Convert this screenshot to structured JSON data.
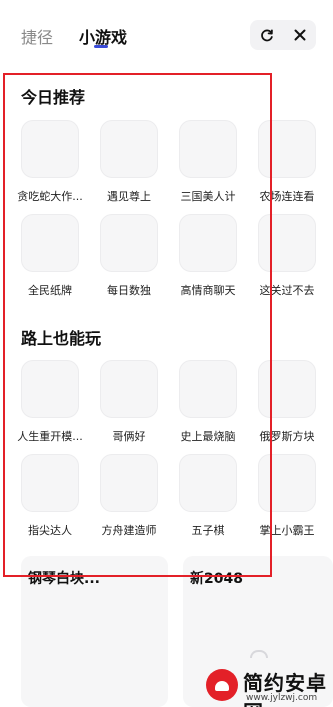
{
  "header": {
    "tabs": [
      {
        "label": "捷径",
        "active": false
      },
      {
        "label": "小游戏",
        "active": true
      }
    ]
  },
  "sections": [
    {
      "title": "今日推荐",
      "games": [
        "贪吃蛇大作...",
        "遇见尊上",
        "三国美人计",
        "农场连连看",
        "全民纸牌",
        "每日数独",
        "高情商聊天",
        "这关过不去"
      ]
    },
    {
      "title": "路上也能玩",
      "games": [
        "人生重开模...",
        "哥俩好",
        "史上最烧脑",
        "俄罗斯方块",
        "指尖达人",
        "方舟建造师",
        "五子棋",
        "掌上小霸王"
      ]
    }
  ],
  "cards": [
    {
      "title": "钢琴白块..."
    },
    {
      "title": "新2048"
    }
  ],
  "watermark": {
    "title": "简约安卓网",
    "url": "www.jylzwj.com"
  },
  "colors": {
    "highlight": "#e32028",
    "tab_indicator": "#3a4bd8",
    "thumb_bg": "#f6f6f7"
  }
}
